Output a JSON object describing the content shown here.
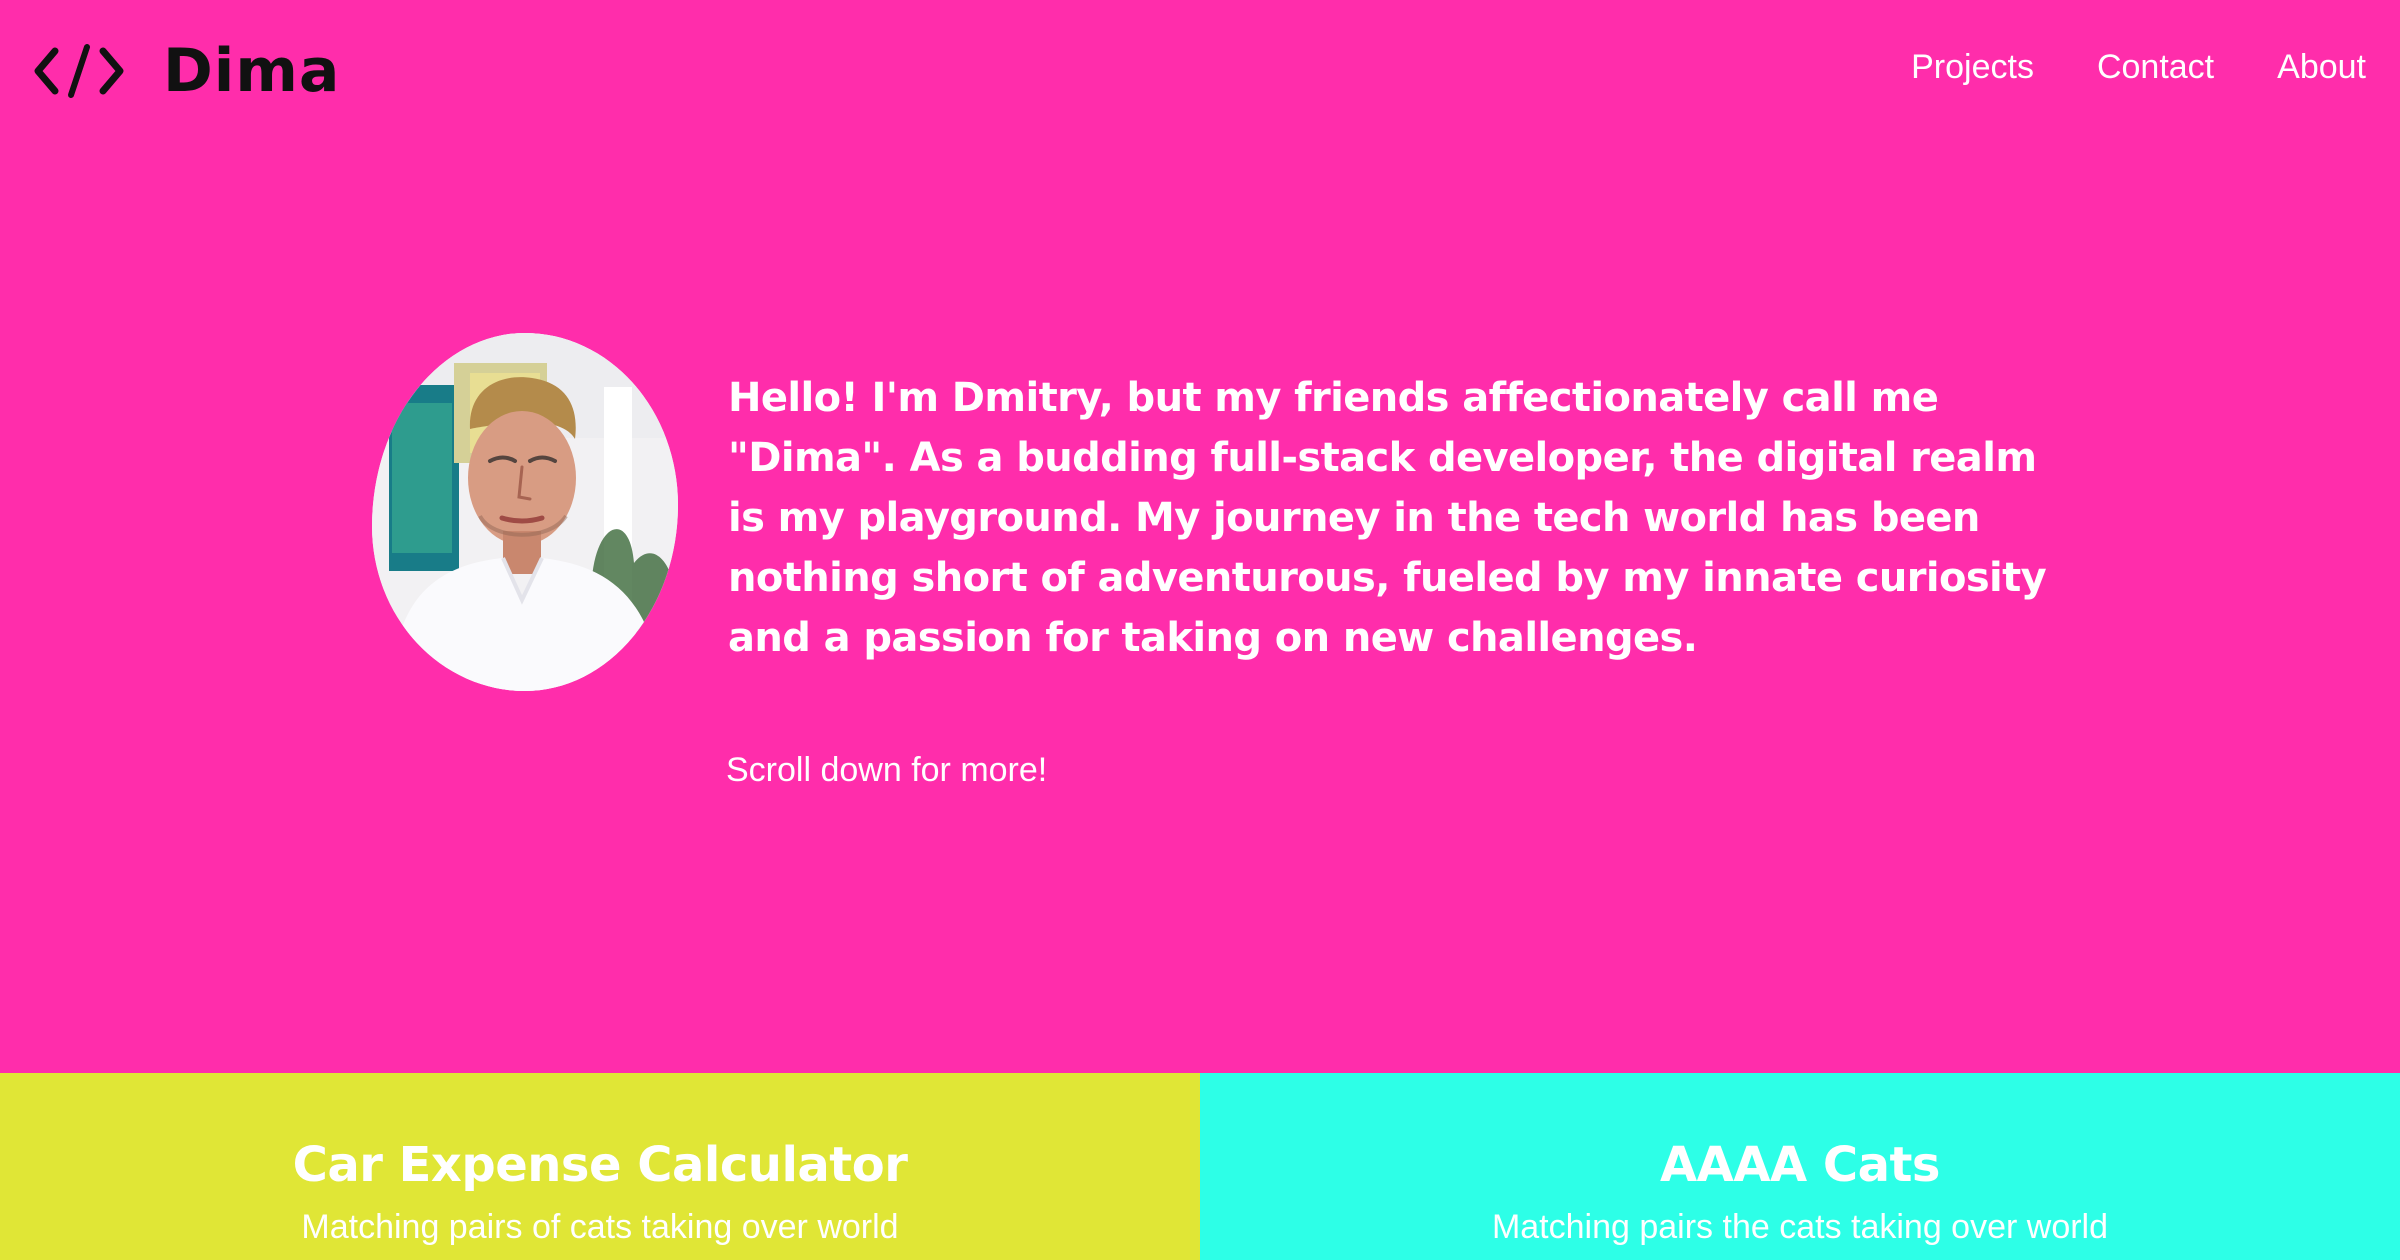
{
  "header": {
    "logo_text": "Dima",
    "logo_icon": "code-brackets-icon",
    "nav": {
      "projects": "Projects",
      "contact": "Contact",
      "about": "About"
    }
  },
  "hero": {
    "avatar": "profile-photo",
    "intro": "Hello! I'm Dmitry, but my friends affectionately call me \"Dima\". As a budding full-stack developer, the digital realm is my playground. My journey in the tech world has been nothing short of adventurous, fueled by my innate curiosity and a passion for taking on new challenges.",
    "scroll_hint": "Scroll down for more!"
  },
  "projects": [
    {
      "title": "Car Expense Calculator",
      "description": "Matching pairs of cats taking over world"
    },
    {
      "title": "AAAA Cats",
      "description": "Matching pairs the cats taking over world"
    }
  ],
  "colors": {
    "background": "#FF2DAB",
    "card_1": "#E0E636",
    "card_2": "#2DFFE7",
    "text": "#FFFFFF",
    "logo": "#111111"
  }
}
